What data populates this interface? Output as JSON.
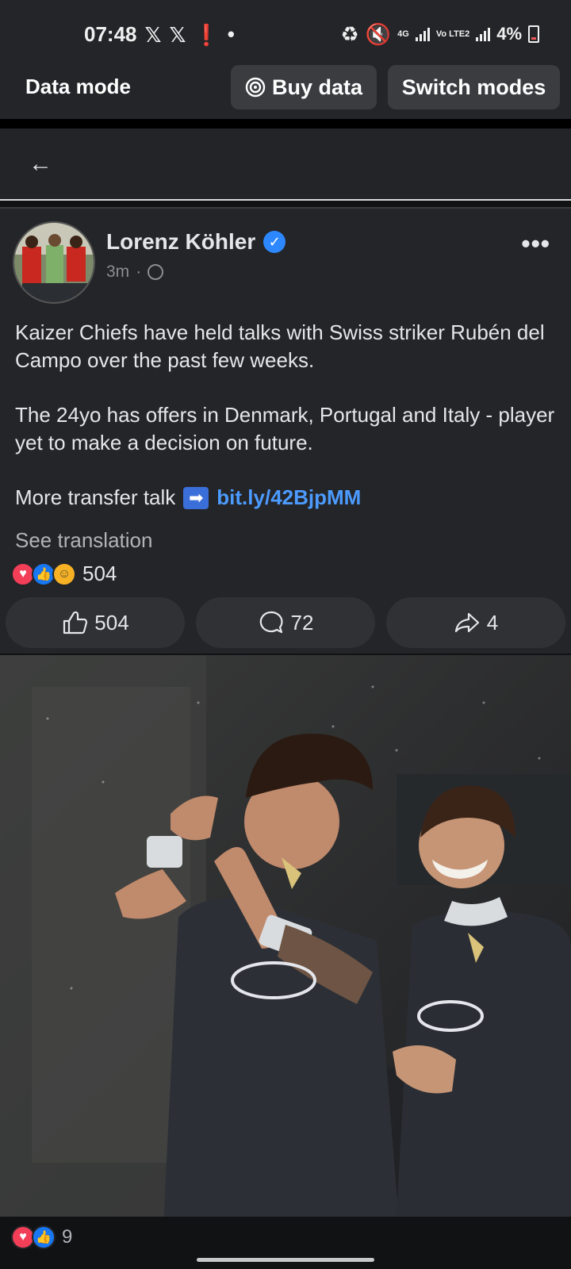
{
  "status_bar": {
    "time": "07:48",
    "battery": "4%",
    "network": "4G",
    "carrier": "Vo LTE2"
  },
  "data_bar": {
    "title": "Data mode",
    "buy_label": "Buy data",
    "switch_label": "Switch modes"
  },
  "post": {
    "author": "Lorenz Köhler",
    "time_ago": "3m",
    "paragraphs": [
      "Kaizer Chiefs have held talks with Swiss striker Rubén del Campo over the past few weeks.",
      "The 24yo has offers in Denmark, Portugal and Italy - player yet to make a decision on future."
    ],
    "link_prefix": "More transfer talk",
    "link_text": "bit.ly/42BjpMM",
    "see_translation": "See translation",
    "reaction_count": "504",
    "actions": {
      "like_count": "504",
      "comment_count": "72",
      "share_count": "4"
    },
    "photo_reaction_count": "9"
  },
  "colors": {
    "accent_link": "#4c9bff",
    "verified": "#2d88ff",
    "background": "#242528"
  }
}
